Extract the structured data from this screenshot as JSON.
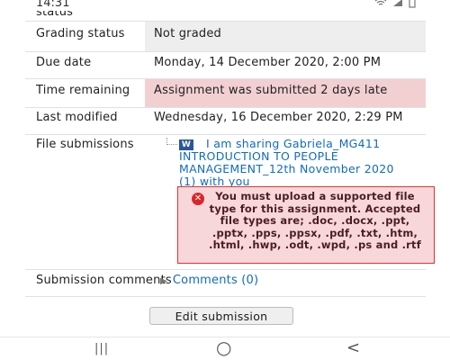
{
  "status_bar": {
    "time": "14:31",
    "icons": [
      "wifi-icon",
      "signal-icon",
      "battery-icon"
    ]
  },
  "rows": {
    "submission_status": {
      "label": "status"
    },
    "grading_status": {
      "label": "Grading status",
      "value": "Not graded"
    },
    "due_date": {
      "label": "Due date",
      "value": "Monday, 14 December 2020, 2:00 PM"
    },
    "time_remaining": {
      "label": "Time remaining",
      "value": "Assignment was submitted 2 days late"
    },
    "last_modified": {
      "label": "Last modified",
      "value": "Wednesday, 16 December 2020, 2:29 PM"
    },
    "file_submissions": {
      "label": "File submissions",
      "file_icon": "word-file-icon",
      "file_name": "I am sharing Gabriela_MG411 INTRODUCTION TO PEOPLE MANAGEMENT_12th November 2020 (1) with you",
      "error_icon": "error-x-icon",
      "error_message": "You must upload a supported file type for this assignment. Accepted file types are; .doc, .docx, .ppt, .pptx, .pps, .ppsx, .pdf, .txt, .htm, .html, .hwp, .odt, .wpd, .ps and .rtf"
    },
    "submission_comments": {
      "label": "Submission comments",
      "link": "Comments (0)"
    }
  },
  "actions": {
    "edit_submission": "Edit submission"
  },
  "nav_bar": {
    "recents": "|||",
    "home": "○",
    "back": "<"
  },
  "colors": {
    "link": "#0f6cbf",
    "late_bg": "#f2d0d1",
    "error_border": "#dd3333"
  }
}
